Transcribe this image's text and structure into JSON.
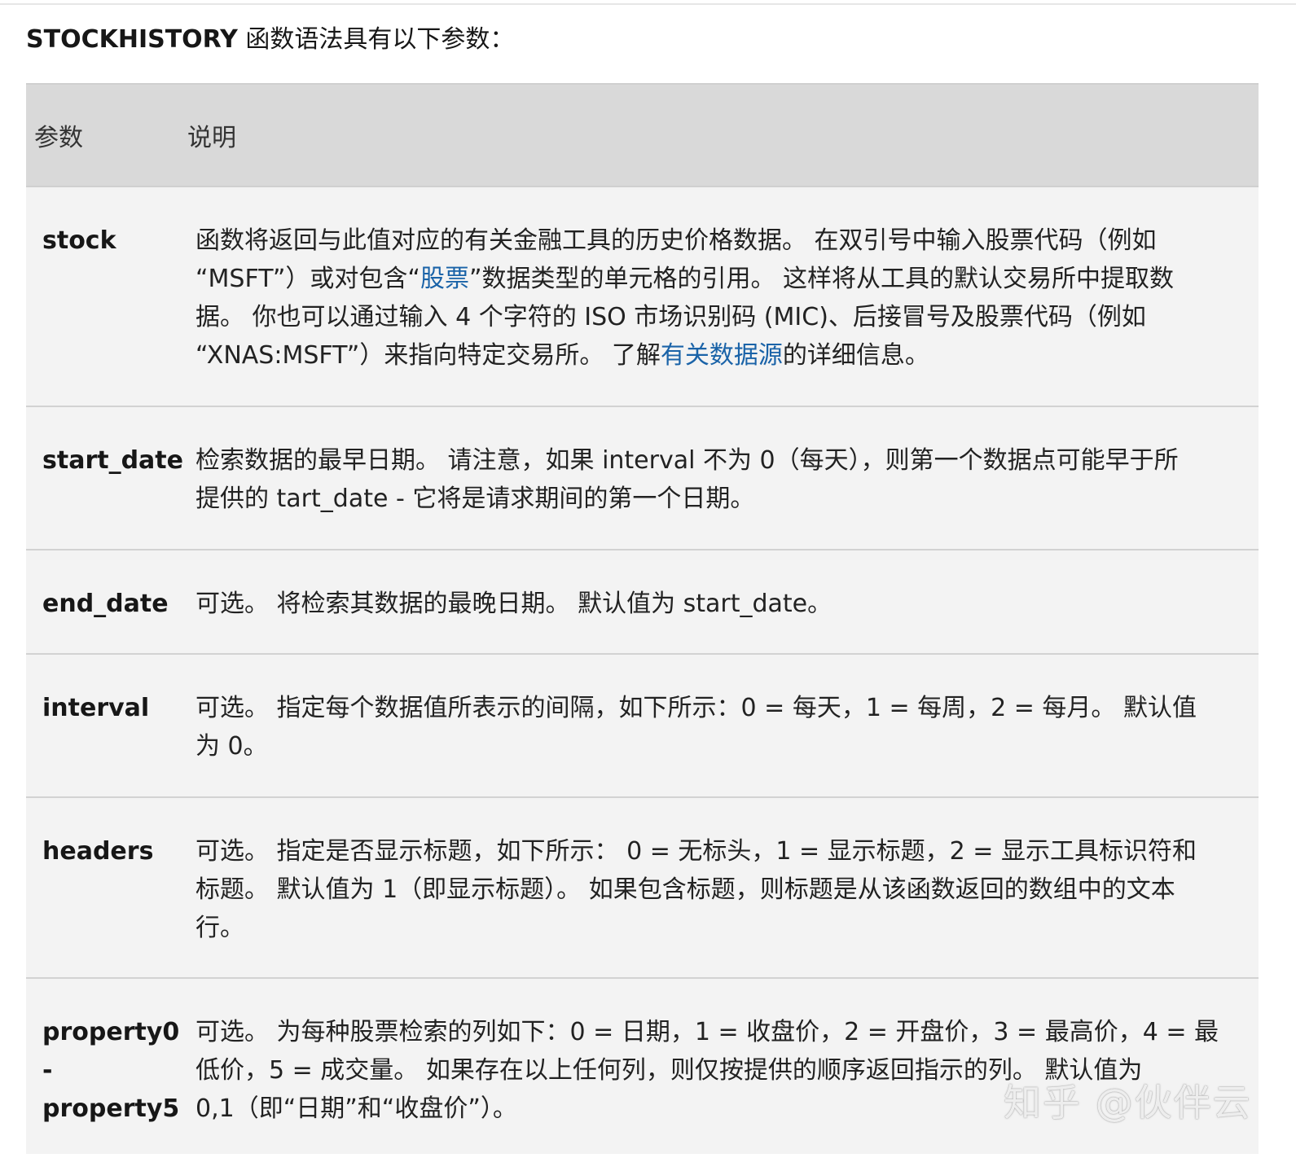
{
  "intro": {
    "function_name": "STOCKHISTORY",
    "text": " 函数语法具有以下参数："
  },
  "table": {
    "header": {
      "param": "参数",
      "desc": "说明"
    },
    "rows": {
      "stock": {
        "name": "stock",
        "desc_l1": "函数将返回与此值对应的有关金融工具的历史价格数据。 在双引号中输入股票代码（例如",
        "desc_l2a": "“MSFT”）或对包含“",
        "desc_l2_link": "股票",
        "desc_l2b": "”数据类型的单元格的引用。 这样将从工具的默认交易所中提取数",
        "desc_l3": "据。 你也可以通过输入 4 个字符的 ISO 市场识别码 (MIC)、后接冒号及股票代码（例如",
        "desc_l4a": "“XNAS:MSFT”）来指向特定交易所。 了解",
        "desc_l4_link": "有关数据源",
        "desc_l4b": "的详细信息。"
      },
      "start_date": {
        "name": "start_date",
        "desc_l1": "检索数据的最早日期。 请注意，如果 interval 不为 0（每天），则第一个数据点可能早于所",
        "desc_l2": "提供的 tart_date - 它将是请求期间的第一个日期。"
      },
      "end_date": {
        "name": "end_date",
        "desc_l1": "可选。 将检索其数据的最晚日期。 默认值为 start_date。"
      },
      "interval": {
        "name": "interval",
        "desc_l1": "可选。 指定每个数据值所表示的间隔，如下所示：0 = 每天，1 = 每周，2 = 每月。 默认值",
        "desc_l2": "为 0。"
      },
      "headers": {
        "name": "headers",
        "desc_l1": "可选。 指定是否显示标题，如下所示： 0 = 无标头，1 = 显示标题，2 = 显示工具标识符和",
        "desc_l2": "标题。 默认值为 1（即显示标题）。 如果包含标题，则标题是从该函数返回的数组中的文本",
        "desc_l3": "行。"
      },
      "property": {
        "name_l1": "property0",
        "name_l2": "-",
        "name_l3": "property5",
        "desc_l1": "可选。 为每种股票检索的列如下：0 = 日期，1 = 收盘价，2 = 开盘价，3 = 最高价，4 = 最",
        "desc_l2": "低价，5 = 成交量。 如果存在以上任何列，则仅按提供的顺序返回指示的列。 默认值为",
        "desc_l3": "0,1（即“日期”和“收盘价”）。"
      }
    }
  },
  "watermark": "知乎 @伙伴云",
  "colors": {
    "header_bg": "#d9d9d9",
    "row_bg": "#f3f3f3",
    "link": "#1a63a8"
  }
}
